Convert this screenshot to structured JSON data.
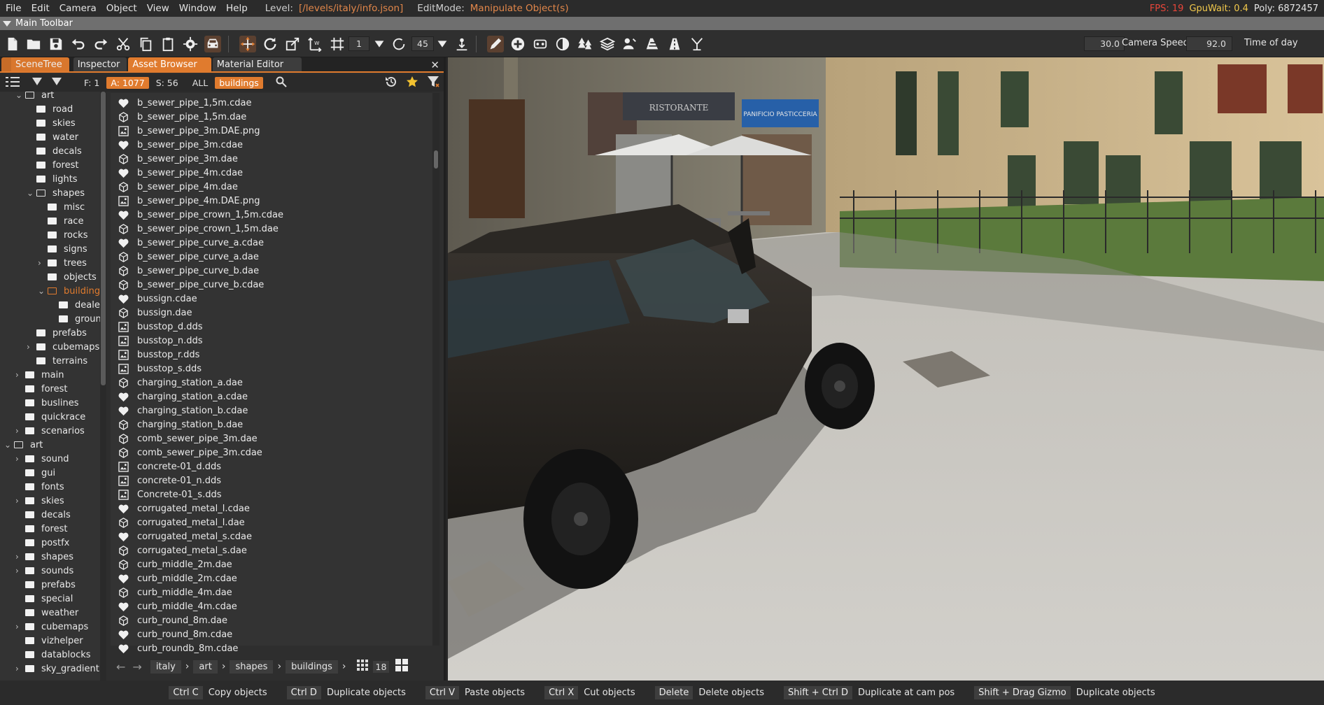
{
  "menubar": {
    "items": [
      "File",
      "Edit",
      "Camera",
      "Object",
      "View",
      "Window",
      "Help"
    ],
    "level_label": "Level:",
    "level_value": "[/levels/italy/info.json]",
    "editmode_label": "EditMode:",
    "editmode_value": "Manipulate Object(s)"
  },
  "stats": {
    "fps": "FPS: 19",
    "gpuwait": "GpuWait: 0.4",
    "poly": "Poly: 6872457"
  },
  "toolbar": {
    "title": "Main Toolbar",
    "snap_value": "1",
    "rotate_value": "45",
    "camera_speed_value": "30.0",
    "camera_speed_label": "Camera Speed",
    "time_of_day_value": "92.0",
    "time_of_day_label": "Time of day"
  },
  "panel": {
    "tabs": [
      "SceneTree",
      "Inspector",
      "Asset Browser",
      "Material Editor"
    ],
    "active_tab": "Asset Browser",
    "filter": {
      "f": "F: 1",
      "a": "A: 1077",
      "s": "S: 56",
      "all": "ALL",
      "tag": "buildings"
    },
    "tree": [
      {
        "label": "art",
        "indent": 1,
        "open": true,
        "partial": true
      },
      {
        "label": "road",
        "indent": 2
      },
      {
        "label": "skies",
        "indent": 2
      },
      {
        "label": "water",
        "indent": 2
      },
      {
        "label": "decals",
        "indent": 2
      },
      {
        "label": "forest",
        "indent": 2
      },
      {
        "label": "lights",
        "indent": 2
      },
      {
        "label": "shapes",
        "indent": 2,
        "open": true
      },
      {
        "label": "misc",
        "indent": 3
      },
      {
        "label": "race",
        "indent": 3
      },
      {
        "label": "rocks",
        "indent": 3
      },
      {
        "label": "signs",
        "indent": 3
      },
      {
        "label": "trees",
        "indent": 3,
        "collapsed": true
      },
      {
        "label": "objects",
        "indent": 3
      },
      {
        "label": "buildings",
        "indent": 3,
        "open": true,
        "selected": true
      },
      {
        "label": "dealersh",
        "indent": 4
      },
      {
        "label": "groundco",
        "indent": 4
      },
      {
        "label": "prefabs",
        "indent": 2
      },
      {
        "label": "cubemaps",
        "indent": 2,
        "collapsed": true
      },
      {
        "label": "terrains",
        "indent": 2
      },
      {
        "label": "main",
        "indent": 1,
        "collapsed": true
      },
      {
        "label": "forest",
        "indent": 1
      },
      {
        "label": "buslines",
        "indent": 1
      },
      {
        "label": "quickrace",
        "indent": 1
      },
      {
        "label": "scenarios",
        "indent": 1,
        "collapsed": true
      },
      {
        "label": "art",
        "indent": 0,
        "open": true
      },
      {
        "label": "sound",
        "indent": 1,
        "collapsed": true
      },
      {
        "label": "gui",
        "indent": 1
      },
      {
        "label": "fonts",
        "indent": 1
      },
      {
        "label": "skies",
        "indent": 1,
        "collapsed": true
      },
      {
        "label": "decals",
        "indent": 1
      },
      {
        "label": "forest",
        "indent": 1
      },
      {
        "label": "postfx",
        "indent": 1
      },
      {
        "label": "shapes",
        "indent": 1,
        "collapsed": true
      },
      {
        "label": "sounds",
        "indent": 1,
        "collapsed": true
      },
      {
        "label": "prefabs",
        "indent": 1
      },
      {
        "label": "special",
        "indent": 1
      },
      {
        "label": "weather",
        "indent": 1
      },
      {
        "label": "cubemaps",
        "indent": 1,
        "collapsed": true
      },
      {
        "label": "vizhelper",
        "indent": 1
      },
      {
        "label": "datablocks",
        "indent": 1
      },
      {
        "label": "sky_gradient",
        "indent": 1,
        "collapsed": true
      }
    ],
    "files": [
      {
        "name": "b_sewer_pipe_1,5m.cdae",
        "icon": "heart"
      },
      {
        "name": "b_sewer_pipe_1,5m.dae",
        "icon": "cube"
      },
      {
        "name": "b_sewer_pipe_3m.DAE.png",
        "icon": "image"
      },
      {
        "name": "b_sewer_pipe_3m.cdae",
        "icon": "heart"
      },
      {
        "name": "b_sewer_pipe_3m.dae",
        "icon": "cube"
      },
      {
        "name": "b_sewer_pipe_4m.cdae",
        "icon": "heart"
      },
      {
        "name": "b_sewer_pipe_4m.dae",
        "icon": "cube"
      },
      {
        "name": "b_sewer_pipe_4m.DAE.png",
        "icon": "image"
      },
      {
        "name": "b_sewer_pipe_crown_1,5m.cdae",
        "icon": "heart"
      },
      {
        "name": "b_sewer_pipe_crown_1,5m.dae",
        "icon": "cube"
      },
      {
        "name": "b_sewer_pipe_curve_a.cdae",
        "icon": "heart"
      },
      {
        "name": "b_sewer_pipe_curve_a.dae",
        "icon": "cube"
      },
      {
        "name": "b_sewer_pipe_curve_b.dae",
        "icon": "cube"
      },
      {
        "name": "b_sewer_pipe_curve_b.cdae",
        "icon": "cube"
      },
      {
        "name": "bussign.cdae",
        "icon": "heart"
      },
      {
        "name": "bussign.dae",
        "icon": "cube"
      },
      {
        "name": "busstop_d.dds",
        "icon": "image"
      },
      {
        "name": "busstop_n.dds",
        "icon": "image"
      },
      {
        "name": "busstop_r.dds",
        "icon": "image"
      },
      {
        "name": "busstop_s.dds",
        "icon": "image"
      },
      {
        "name": "charging_station_a.dae",
        "icon": "cube"
      },
      {
        "name": "charging_station_a.cdae",
        "icon": "heart"
      },
      {
        "name": "charging_station_b.cdae",
        "icon": "heart"
      },
      {
        "name": "charging_station_b.dae",
        "icon": "cube"
      },
      {
        "name": "comb_sewer_pipe_3m.dae",
        "icon": "cube"
      },
      {
        "name": "comb_sewer_pipe_3m.cdae",
        "icon": "cube"
      },
      {
        "name": "concrete-01_d.dds",
        "icon": "image"
      },
      {
        "name": "concrete-01_n.dds",
        "icon": "image"
      },
      {
        "name": "Concrete-01_s.dds",
        "icon": "image"
      },
      {
        "name": "corrugated_metal_l.cdae",
        "icon": "heart"
      },
      {
        "name": "corrugated_metal_l.dae",
        "icon": "cube"
      },
      {
        "name": "corrugated_metal_s.cdae",
        "icon": "heart"
      },
      {
        "name": "corrugated_metal_s.dae",
        "icon": "cube"
      },
      {
        "name": "curb_middle_2m.dae",
        "icon": "cube"
      },
      {
        "name": "curb_middle_2m.cdae",
        "icon": "heart"
      },
      {
        "name": "curb_middle_4m.dae",
        "icon": "cube"
      },
      {
        "name": "curb_middle_4m.cdae",
        "icon": "heart"
      },
      {
        "name": "curb_round_8m.dae",
        "icon": "cube"
      },
      {
        "name": "curb_round_8m.cdae",
        "icon": "heart"
      },
      {
        "name": "curb_roundb_8m.cdae",
        "icon": "heart"
      }
    ],
    "breadcrumbs": [
      "italy",
      "art",
      "shapes",
      "buildings"
    ],
    "thumb_size": "18"
  },
  "statusbar": [
    {
      "key": "Ctrl C",
      "action": "Copy objects"
    },
    {
      "key": "Ctrl D",
      "action": "Duplicate objects"
    },
    {
      "key": "Ctrl V",
      "action": "Paste objects"
    },
    {
      "key": "Ctrl X",
      "action": "Cut objects"
    },
    {
      "key": "Delete",
      "action": "Delete objects"
    },
    {
      "key": "Shift + Ctrl D",
      "action": "Duplicate at cam pos"
    },
    {
      "key": "Shift + Drag Gizmo",
      "action": "Duplicate objects"
    }
  ],
  "viewport": {
    "sign1": "RISTORANTE",
    "sign2": "PANIFICIO PASTICCERIA"
  },
  "colors": {
    "accent": "#e07b2e",
    "fps": "#e8463a",
    "gpuwait": "#f2c94c",
    "panel_bg": "#333333"
  }
}
